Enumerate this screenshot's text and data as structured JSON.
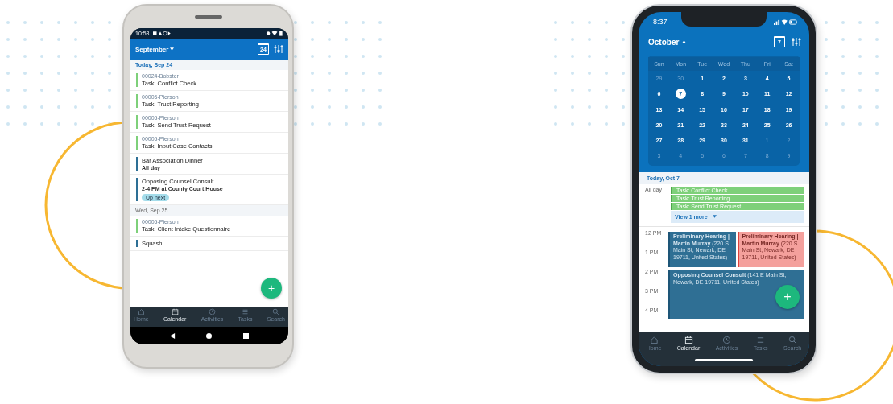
{
  "android": {
    "status_time": "10:53",
    "month": "September",
    "calendar_day": "24",
    "sections": [
      {
        "date": "Today, Sep 24",
        "today": true,
        "items": [
          {
            "kind": "task",
            "matter": "00024-Bobster",
            "title": "Task: Conflict Check",
            "color": "#7ed07a"
          },
          {
            "kind": "task",
            "matter": "00005-Pierson",
            "title": "Task: Trust Reporting",
            "color": "#7ed07a"
          },
          {
            "kind": "task",
            "matter": "00005-Pierson",
            "title": "Task: Send Trust Request",
            "color": "#7ed07a"
          },
          {
            "kind": "task",
            "matter": "00005-Pierson",
            "title": "Task: Input Case Contacts",
            "color": "#7ed07a"
          },
          {
            "kind": "event",
            "title": "Bar Association Dinner",
            "subtitle": "All day",
            "color": "#2d6f95"
          },
          {
            "kind": "event",
            "title": "Opposing Counsel Consult",
            "subtitle": "2-4 PM at County Court House",
            "badge": "Up next",
            "color": "#2d6f95"
          }
        ]
      },
      {
        "date": "Wed, Sep 25",
        "today": false,
        "items": [
          {
            "kind": "task",
            "matter": "00005-Pierson",
            "title": "Task: Client Intake Questionnaire",
            "color": "#7ed07a"
          },
          {
            "kind": "event",
            "title": "Squash",
            "color": "#2d6f95"
          }
        ]
      }
    ],
    "fab": "+",
    "nav": [
      {
        "label": "Home",
        "selected": false
      },
      {
        "label": "Calendar",
        "selected": true
      },
      {
        "label": "Activities",
        "selected": false
      },
      {
        "label": "Tasks",
        "selected": false
      },
      {
        "label": "Search",
        "selected": false
      }
    ]
  },
  "iphone": {
    "status_time": "8:37",
    "month": "October",
    "calendar_day": "7",
    "weekdays": [
      "Sun",
      "Mon",
      "Tue",
      "Wed",
      "Thu",
      "Fri",
      "Sat"
    ],
    "weeks": [
      [
        {
          "day": "29",
          "muted": true,
          "selected": false
        },
        {
          "day": "30",
          "muted": true,
          "selected": false
        },
        {
          "day": "1",
          "muted": false,
          "selected": false
        },
        {
          "day": "2",
          "muted": false,
          "selected": false
        },
        {
          "day": "3",
          "muted": false,
          "selected": false
        },
        {
          "day": "4",
          "muted": false,
          "selected": false
        },
        {
          "day": "5",
          "muted": false,
          "selected": false
        }
      ],
      [
        {
          "day": "6",
          "muted": false,
          "selected": false
        },
        {
          "day": "7",
          "muted": false,
          "selected": true
        },
        {
          "day": "8",
          "muted": false,
          "selected": false
        },
        {
          "day": "9",
          "muted": false,
          "selected": false
        },
        {
          "day": "10",
          "muted": false,
          "selected": false
        },
        {
          "day": "11",
          "muted": false,
          "selected": false
        },
        {
          "day": "12",
          "muted": false,
          "selected": false
        }
      ],
      [
        {
          "day": "13",
          "muted": false,
          "selected": false
        },
        {
          "day": "14",
          "muted": false,
          "selected": false
        },
        {
          "day": "15",
          "muted": false,
          "selected": false
        },
        {
          "day": "16",
          "muted": false,
          "selected": false
        },
        {
          "day": "17",
          "muted": false,
          "selected": false
        },
        {
          "day": "18",
          "muted": false,
          "selected": false
        },
        {
          "day": "19",
          "muted": false,
          "selected": false
        }
      ],
      [
        {
          "day": "20",
          "muted": false,
          "selected": false
        },
        {
          "day": "21",
          "muted": false,
          "selected": false
        },
        {
          "day": "22",
          "muted": false,
          "selected": false
        },
        {
          "day": "23",
          "muted": false,
          "selected": false
        },
        {
          "day": "24",
          "muted": false,
          "selected": false
        },
        {
          "day": "25",
          "muted": false,
          "selected": false
        },
        {
          "day": "26",
          "muted": false,
          "selected": false
        }
      ],
      [
        {
          "day": "27",
          "muted": false,
          "selected": false
        },
        {
          "day": "28",
          "muted": false,
          "selected": false
        },
        {
          "day": "29",
          "muted": false,
          "selected": false
        },
        {
          "day": "30",
          "muted": false,
          "selected": false
        },
        {
          "day": "31",
          "muted": false,
          "selected": false
        },
        {
          "day": "1",
          "muted": true,
          "selected": false
        },
        {
          "day": "2",
          "muted": true,
          "selected": false
        }
      ],
      [
        {
          "day": "3",
          "muted": true,
          "selected": false
        },
        {
          "day": "4",
          "muted": true,
          "selected": false
        },
        {
          "day": "5",
          "muted": true,
          "selected": false
        },
        {
          "day": "6",
          "muted": true,
          "selected": false
        },
        {
          "day": "7",
          "muted": true,
          "selected": false
        },
        {
          "day": "8",
          "muted": true,
          "selected": false
        },
        {
          "day": "9",
          "muted": true,
          "selected": false
        }
      ]
    ],
    "today_label": "Today, Oct 7",
    "all_day_label": "All day",
    "all_day_events": [
      {
        "title": "Task: Conflict Check",
        "color": "#7ed07a"
      },
      {
        "title": "Task: Trust Reporting",
        "color": "#7ed07a"
      },
      {
        "title": "Task: Send Trust Request",
        "color": "#7ed07a"
      }
    ],
    "view_more": "View 1 more",
    "time_labels": [
      "12 PM",
      "1 PM",
      "2 PM",
      "3 PM",
      "4 PM"
    ],
    "event_rows": [
      [
        {
          "text": "**Preliminary Hearing | Martin Murray** (220 S Main St, Newark, DE 19711, United States)",
          "color": "#2f6f94"
        },
        {
          "text": "**Preliminary Hearing | Martin Murray** (220 S Main St, Newark, DE 19711, United States)",
          "color": "#f4a09c"
        }
      ],
      [
        {
          "text": "**Opposing Counsel Consult** (141 E Main St, Newark, DE 19711, United States)",
          "color": "#2f6f94"
        }
      ]
    ],
    "fab": "+",
    "nav": [
      {
        "label": "Home",
        "selected": false
      },
      {
        "label": "Calendar",
        "selected": true
      },
      {
        "label": "Activities",
        "selected": false
      },
      {
        "label": "Tasks",
        "selected": false
      },
      {
        "label": "Search",
        "selected": false
      }
    ]
  }
}
